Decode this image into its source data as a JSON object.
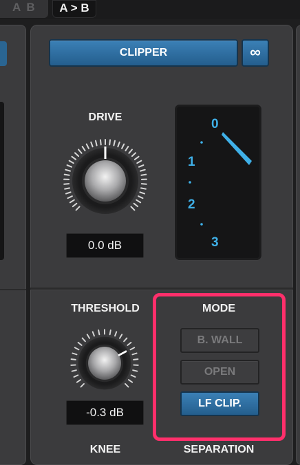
{
  "topbar": {
    "ab_label": "A B",
    "atob_label": "A > B"
  },
  "header": {
    "clipper_label": "CLIPPER",
    "link_label": "∞"
  },
  "drive": {
    "label": "DRIVE",
    "value": "0.0 dB"
  },
  "meter": {
    "scale": [
      "0",
      "1",
      "2",
      "3"
    ]
  },
  "threshold": {
    "label": "THRESHOLD",
    "value": "-0.3 dB"
  },
  "mode": {
    "label": "MODE",
    "options": [
      {
        "label": "B. WALL",
        "selected": false
      },
      {
        "label": "OPEN",
        "selected": false
      },
      {
        "label": "LF CLIP.",
        "selected": true
      }
    ]
  },
  "bottom": {
    "knee_label": "KNEE",
    "separation_label": "SEPARATION"
  },
  "colors": {
    "accent": "#2f72a6",
    "highlight": "#ff2f6b",
    "meter_text": "#3fb0e8"
  }
}
